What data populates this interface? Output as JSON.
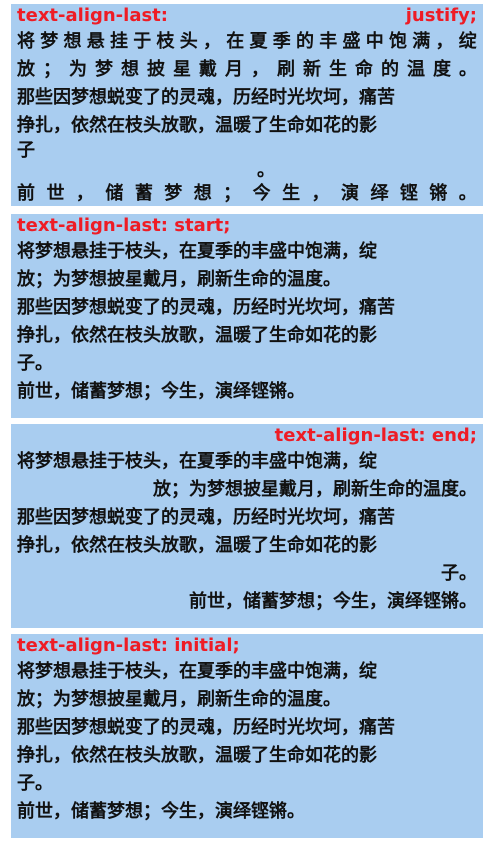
{
  "demos": [
    {
      "id": "justify",
      "head_left": "text-align-last:",
      "head_right": "justify;",
      "lines": [
        "将梦想悬挂于枝头，在夏季的丰盛中饱满，绽",
        "放；为梦想披星戴月，刷新生命的温度。",
        "那些因梦想蜕变了的灵魂，历经时光坎坷，痛苦",
        "挣扎，依然在枝头放歌，温暖了生命如花的影",
        "子",
        "。",
        "前世，储蓄梦想；今生，演绎铿锵。"
      ]
    },
    {
      "id": "start",
      "head": "text-align-last: start;",
      "lines": [
        "将梦想悬挂于枝头，在夏季的丰盛中饱满，绽",
        "放；为梦想披星戴月，刷新生命的温度。",
        "那些因梦想蜕变了的灵魂，历经时光坎坷，痛苦",
        "挣扎，依然在枝头放歌，温暖了生命如花的影",
        "子。",
        "前世，储蓄梦想；今生，演绎铿锵。"
      ]
    },
    {
      "id": "end",
      "head": "text-align-last: end;",
      "lines": [
        "将梦想悬挂于枝头，在夏季的丰盛中饱满，绽",
        "放；为梦想披星戴月，刷新生命的温度。",
        "那些因梦想蜕变了的灵魂，历经时光坎坷，痛苦",
        "挣扎，依然在枝头放歌，温暖了生命如花的影",
        "子。",
        "前世，储蓄梦想；今生，演绎铿锵。"
      ]
    },
    {
      "id": "initial",
      "head": "text-align-last: initial;",
      "lines": [
        "将梦想悬挂于枝头，在夏季的丰盛中饱满，绽",
        "放；为梦想披星戴月，刷新生命的温度。",
        "那些因梦想蜕变了的灵魂，历经时光坎坷，痛苦",
        "挣扎，依然在枝头放歌，温暖了生命如花的影",
        "子。",
        "前世，储蓄梦想；今生，演绎铿锵。"
      ]
    }
  ],
  "colors": {
    "panel_bg": "#a9cdf0",
    "heading": "#ee1c25",
    "text": "#111111"
  }
}
